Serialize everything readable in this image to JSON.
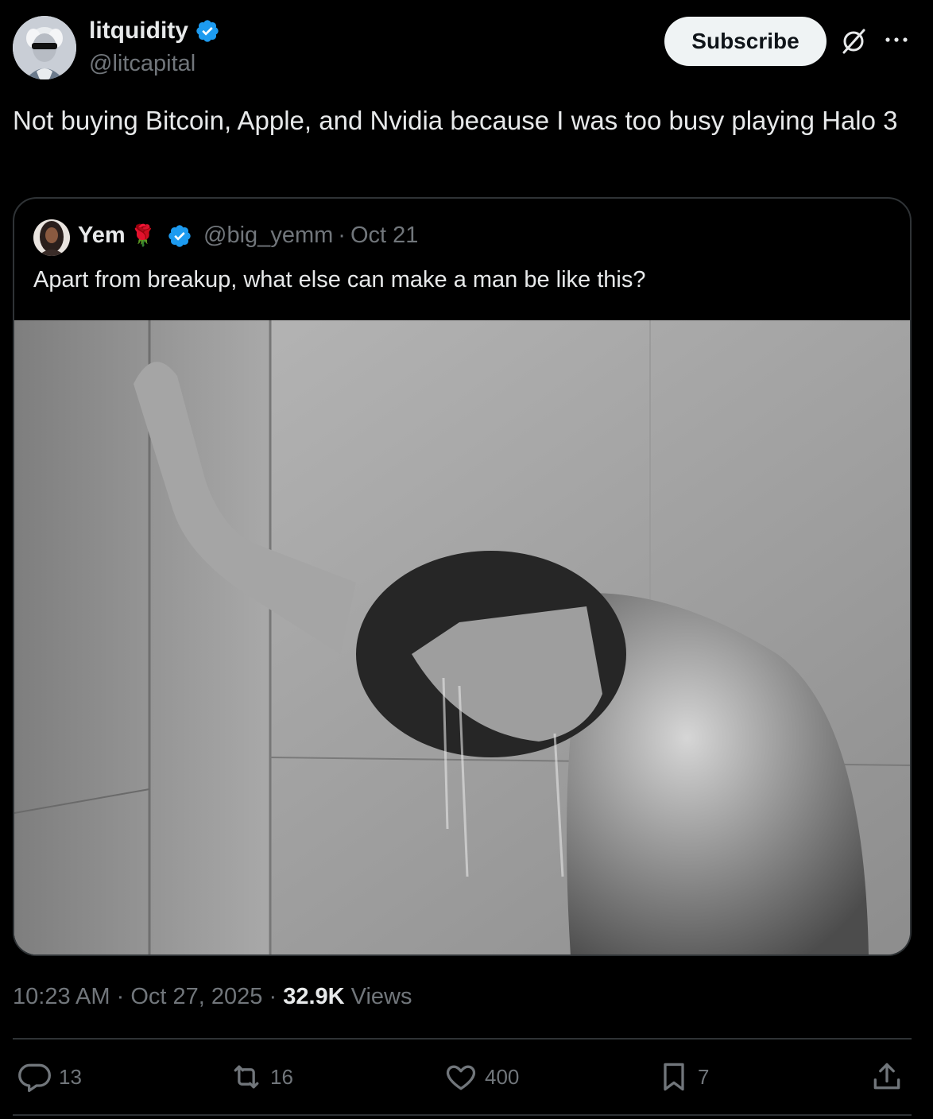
{
  "author": {
    "display_name": "litquidity",
    "handle": "@litcapital",
    "verified": true
  },
  "header": {
    "subscribe_label": "Subscribe",
    "grok_icon": "grok-icon",
    "more_icon": "more-icon"
  },
  "tweet": {
    "text": "Not buying Bitcoin, Apple, and Nvidia because I was too busy playing Halo 3"
  },
  "quoted": {
    "display_name": "Yem",
    "emoji": "🌹",
    "handle": "@big_yemm",
    "separator": "·",
    "date": "Oct 21",
    "text": "Apart from breakup, what else can make a man be like this?",
    "media": "black and white photo of a man leaning against a shower wall"
  },
  "meta": {
    "time": "10:23 AM",
    "separator": "·",
    "date": "Oct 27, 2025",
    "views_count": "32.9K",
    "views_label": "Views"
  },
  "actions": {
    "replies": "13",
    "reposts": "16",
    "likes": "400",
    "bookmarks": "7"
  },
  "colors": {
    "background": "#000000",
    "text": "#e7e9ea",
    "muted": "#71767b",
    "border": "#2f3336",
    "verified": "#1d9bf0"
  }
}
